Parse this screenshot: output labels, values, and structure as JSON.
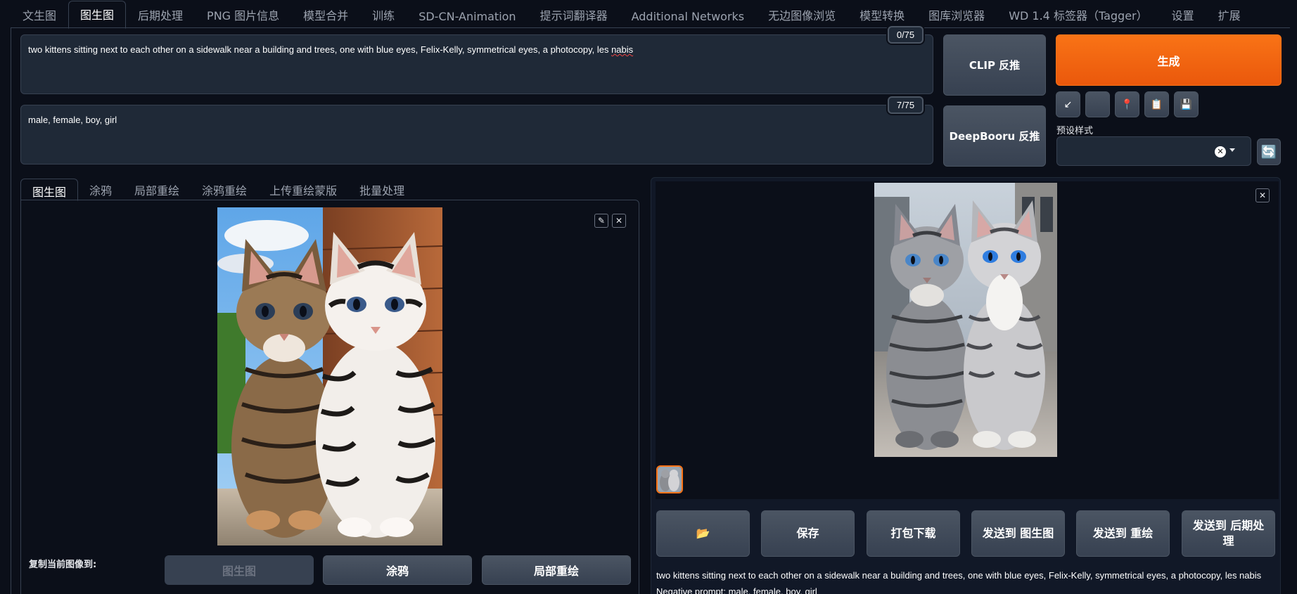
{
  "top_tabs": [
    "文生图",
    "图生图",
    "后期处理",
    "PNG 图片信息",
    "模型合并",
    "训练",
    "SD-CN-Animation",
    "提示词翻译器",
    "Additional Networks",
    "无边图像浏览",
    "模型转换",
    "图库浏览器",
    "WD 1.4 标签器（Tagger）",
    "设置",
    "扩展"
  ],
  "prompt": {
    "positive_before": "two kittens sitting next to each other on a sidewalk near a building and trees, one with blue eyes, Felix-Kelly, symmetrical eyes, a photocopy, les ",
    "positive_misspelled": "nabis",
    "positive_counter": "0/75",
    "negative": "male, female, boy, girl",
    "negative_counter": "7/75"
  },
  "buttons": {
    "clip": "CLIP 反推",
    "deepbooru": "DeepBooru 反推",
    "generate": "生成"
  },
  "tools": [
    {
      "icon": "arrow-icon",
      "glyph": "↙"
    },
    {
      "icon": "blank-icon",
      "glyph": ""
    },
    {
      "icon": "pin-icon",
      "glyph": "📍"
    },
    {
      "icon": "clipboard-icon",
      "glyph": "📋"
    },
    {
      "icon": "save-icon",
      "glyph": "💾"
    }
  ],
  "preset": {
    "label": "预设样式",
    "value": ""
  },
  "sub_tabs": [
    "图生图",
    "涂鸦",
    "局部重绘",
    "涂鸦重绘",
    "上传重绘蒙版",
    "批量处理"
  ],
  "copy": {
    "label": "复制当前图像到:",
    "buttons": [
      "图生图",
      "涂鸦",
      "局部重绘"
    ]
  },
  "output_buttons": [
    {
      "name": "open-folder-button",
      "label": "📂"
    },
    {
      "name": "save-button",
      "label": "保存"
    },
    {
      "name": "zip-download-button",
      "label": "打包下载"
    },
    {
      "name": "send-to-img2img-button",
      "label": "发送到 图生图"
    },
    {
      "name": "send-to-inpaint-button",
      "label": "发送到 重绘"
    },
    {
      "name": "send-to-extras-button",
      "label": "发送到 后期处理"
    }
  ],
  "info": {
    "prompt": "two kittens sitting next to each other on a sidewalk near a building and trees, one with blue eyes, Felix-Kelly, symmetrical eyes, a photocopy, les nabis",
    "negative": "Negative prompt: male, female, boy, girl"
  },
  "colors": {
    "accent": "#f97316",
    "background": "#0b0f19",
    "panel": "#1f2937"
  }
}
